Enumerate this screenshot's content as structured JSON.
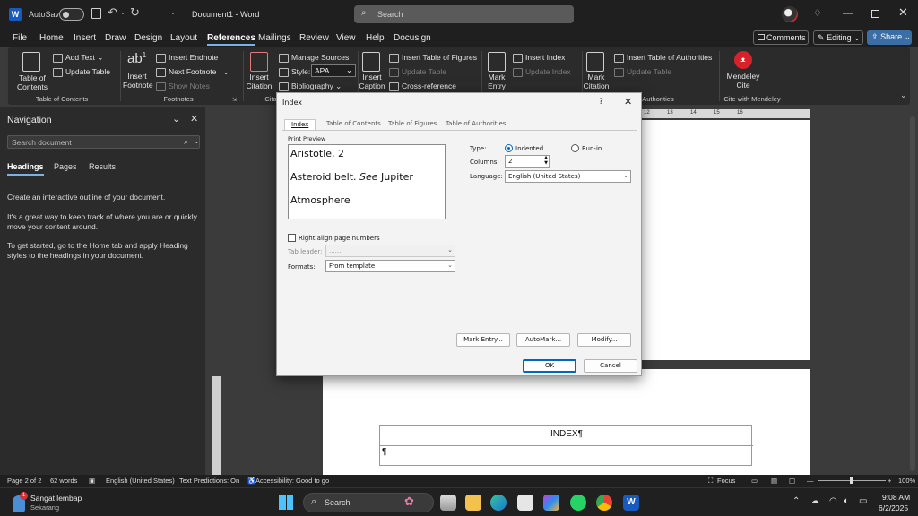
{
  "titlebar": {
    "autosave_label": "AutoSave",
    "autosave_state": "Off",
    "doc_title": "Document1 - Word",
    "search_placeholder": "Search"
  },
  "menu": {
    "items": [
      "File",
      "Home",
      "Insert",
      "Draw",
      "Design",
      "Layout",
      "References",
      "Mailings",
      "Review",
      "View",
      "Help",
      "Docusign"
    ],
    "active": "References",
    "comments_label": "Comments",
    "editing_label": "Editing",
    "share_label": "Share"
  },
  "ribbon": {
    "toc": {
      "label": "Table of Contents",
      "add_text": "Add Text",
      "update_table": "Update Table",
      "group": "Table of Contents"
    },
    "footnotes": {
      "insert_footnote": "Insert Footnote",
      "insert_endnote": "Insert Endnote",
      "next_footnote": "Next Footnote",
      "show_notes": "Show Notes",
      "group": "Footnotes"
    },
    "citations": {
      "insert_citation": "Insert Citation",
      "manage_sources": "Manage Sources",
      "style_label": "Style:",
      "style_value": "APA",
      "bibliography": "Bibliography",
      "group": "Citatio"
    },
    "captions": {
      "insert_caption": "Insert Caption",
      "insert_tof": "Insert Table of Figures",
      "update_table": "Update Table",
      "cross_reference": "Cross-reference"
    },
    "index": {
      "mark_entry": "Mark Entry",
      "insert_index": "Insert Index",
      "update_index": "Update Index"
    },
    "authorities": {
      "mark_citation": "Mark Citation",
      "insert_toa": "Insert Table of Authorities",
      "update_table": "Update Table",
      "group": "Authorities"
    },
    "mendeley": {
      "label": "Mendeley Cite",
      "group": "Cite with Mendeley"
    }
  },
  "navigation": {
    "title": "Navigation",
    "search_placeholder": "Search document",
    "tabs": [
      "Headings",
      "Pages",
      "Results"
    ],
    "active_tab": "Headings",
    "body_1": "Create an interactive outline of your document.",
    "body_2": "It's a great way to keep track of where you are or quickly move your content around.",
    "body_3": "To get started, go to the Home tab and apply Heading styles to the headings in your document."
  },
  "ruler": {
    "numbers": [
      "12",
      "13",
      "14",
      "15",
      "16"
    ]
  },
  "dialog": {
    "title": "Index",
    "help": "?",
    "tabs": [
      "Index",
      "Table of Contents",
      "Table of Figures",
      "Table of Authorities"
    ],
    "active_tab": "Index",
    "print_preview_label": "Print Preview",
    "preview_lines": [
      "Aristotle, 2",
      "Asteroid belt. ",
      "See",
      " Jupiter",
      "Atmosphere"
    ],
    "type_label": "Type:",
    "type_options": [
      "Indented",
      "Run-in"
    ],
    "type_selected": "Indented",
    "columns_label": "Columns:",
    "columns_value": "2",
    "language_label": "Language:",
    "language_value": "English (United States)",
    "right_align_label": "Right align page numbers",
    "right_align_checked": false,
    "tab_leader_label": "Tab leader:",
    "tab_leader_value": ".......",
    "formats_label": "Formats:",
    "formats_value": "From template",
    "mark_entry_button": "Mark Entry...",
    "automark_button": "AutoMark...",
    "modify_button": "Modify...",
    "ok_button": "OK",
    "cancel_button": "Cancel"
  },
  "document": {
    "table_heading": "INDEX¶",
    "pilcrow": "¶"
  },
  "statusbar": {
    "page": "Page 2 of 2",
    "words": "62 words",
    "language": "English (United States)",
    "text_predictions": "Text Predictions: On",
    "accessibility": "Accessibility: Good to go",
    "focus": "Focus",
    "zoom": "100%"
  },
  "taskbar": {
    "notification_count": "1",
    "weather_title": "Sangat lembap",
    "weather_sub": "Sekarang",
    "search_label": "Search",
    "time": "9:08 AM",
    "date": "6/2/2025"
  },
  "colors": {
    "accent": "#7ab2e6",
    "dialog_bg": "#f3f3f3",
    "mendeley": "#d7212b",
    "radio_selected": "#0067c0"
  }
}
